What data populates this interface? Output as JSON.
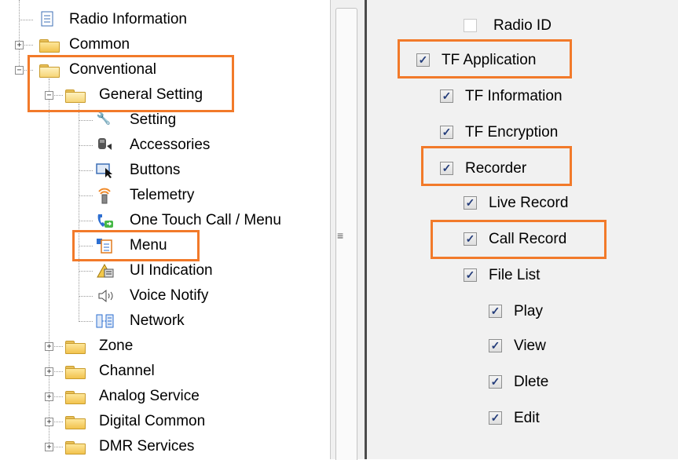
{
  "tree": {
    "items": [
      {
        "label": "Radio Information",
        "icon": "document-icon"
      },
      {
        "label": "Common",
        "icon": "folder-icon"
      },
      {
        "label": "Conventional",
        "icon": "folder-open-icon"
      },
      {
        "label": "General Setting",
        "icon": "folder-open-icon"
      },
      {
        "label": "Setting",
        "icon": "wrench-icon"
      },
      {
        "label": "Accessories",
        "icon": "accessory-icon"
      },
      {
        "label": "Buttons",
        "icon": "cursor-button-icon"
      },
      {
        "label": "Telemetry",
        "icon": "telemetry-icon"
      },
      {
        "label": "One Touch Call / Menu",
        "icon": "phone-icon"
      },
      {
        "label": "Menu",
        "icon": "menu-list-icon"
      },
      {
        "label": "UI Indication",
        "icon": "ui-indication-icon"
      },
      {
        "label": "Voice Notify",
        "icon": "speaker-icon"
      },
      {
        "label": "Network",
        "icon": "network-icon"
      },
      {
        "label": "Zone",
        "icon": "folder-icon"
      },
      {
        "label": "Channel",
        "icon": "folder-icon"
      },
      {
        "label": "Analog Service",
        "icon": "folder-icon"
      },
      {
        "label": "Digital Common",
        "icon": "folder-icon"
      },
      {
        "label": "DMR Services",
        "icon": "folder-icon"
      }
    ],
    "expanders": {
      "collapsed": "+",
      "expanded": "−"
    },
    "highlighted": [
      "Conventional",
      "General Setting",
      "Menu"
    ]
  },
  "splitter": {
    "grip_glyph": "≡"
  },
  "settings": {
    "check_glyph": "✓",
    "items": [
      {
        "label": "Radio ID",
        "checked": false
      },
      {
        "label": "TF Application",
        "checked": true
      },
      {
        "label": "TF Information",
        "checked": true
      },
      {
        "label": "TF Encryption",
        "checked": true
      },
      {
        "label": "Recorder",
        "checked": true
      },
      {
        "label": "Live Record",
        "checked": true
      },
      {
        "label": "Call Record",
        "checked": true
      },
      {
        "label": "File List",
        "checked": true
      },
      {
        "label": "Play",
        "checked": true
      },
      {
        "label": "View",
        "checked": true
      },
      {
        "label": "Dlete",
        "checked": true
      },
      {
        "label": "Edit",
        "checked": true
      }
    ],
    "highlighted": [
      "TF Application",
      "Recorder",
      "Call Record"
    ]
  },
  "colors": {
    "highlight": "#f27a2a",
    "panel_bg": "#f1f1f1",
    "check": "#233c7a"
  }
}
